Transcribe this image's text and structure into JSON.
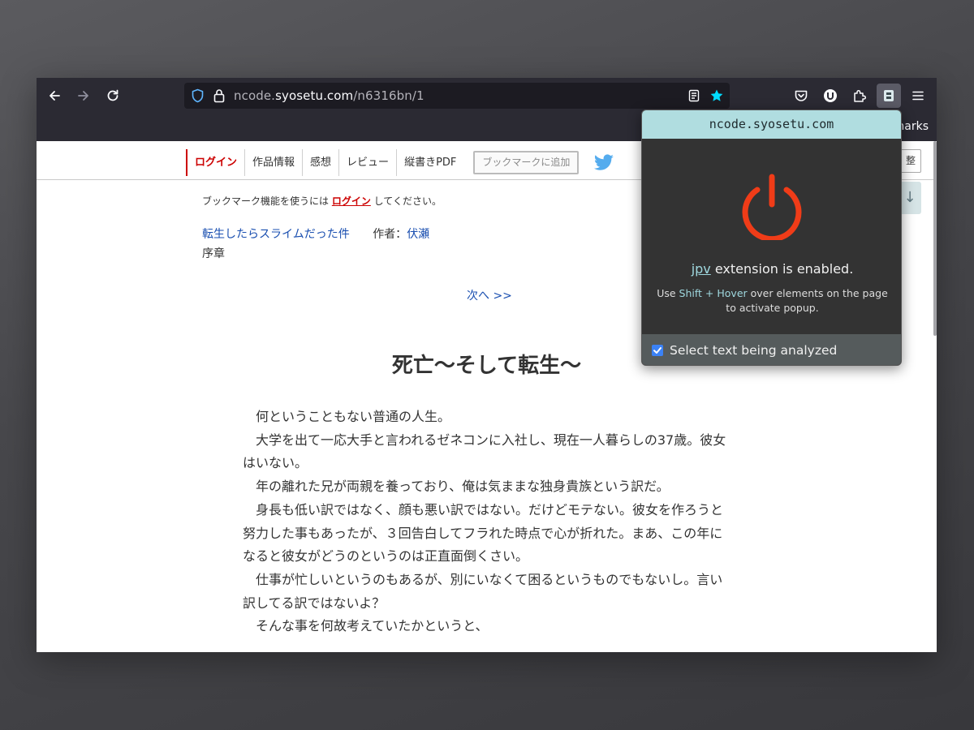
{
  "browser": {
    "url_host_prefix": "ncode.",
    "url_host_main": "syosetu.com",
    "url_path": "/n6316bn/1",
    "bookmarks_label": "harks"
  },
  "nav": {
    "login": "ログイン",
    "work_info": "作品情報",
    "impressions": "感想",
    "review": "レビュー",
    "vertical_pdf": "縦書きPDF",
    "add_bookmark": "ブックマークに追加",
    "adjust": "整",
    "down_arrow": "↓"
  },
  "notice": {
    "before": "ブックマーク機能を使うには ",
    "login": "ログイン",
    "after": " してください。"
  },
  "series": {
    "title": "転生したらスライムだった件",
    "author_label": "作者：",
    "author": "伏瀬",
    "chapter": "序章"
  },
  "next_label": "次へ >>",
  "chapter_title": "死亡～そして転生～",
  "paragraphs": [
    "何ということもない普通の人生。",
    "大学を出て一応大手と言われるゼネコンに入社し、現在一人暮らしの37歳。彼女はいない。",
    "年の離れた兄が両親を養っており、俺は気ままな独身貴族という訳だ。",
    "身長も低い訳ではなく、顔も悪い訳ではない。だけどモテない。彼女を作ろうと努力した事もあったが、３回告白してフラれた時点で心が折れた。まあ、この年になると彼女がどうのというのは正直面倒くさい。",
    "仕事が忙しいというのもあるが、別にいなくて困るというものでもないし。言い訳してる訳ではないよ？",
    "そんな事を何故考えていたかというと、"
  ],
  "popup": {
    "domain": "ncode.syosetu.com",
    "ext_name": "jpv",
    "status_suffix": " extension is enabled.",
    "hint_use": "Use ",
    "hint_keys": "Shift + Hover",
    "hint_rest": " over elements on the page to activate popup.",
    "checkbox_label": "Select text being analyzed",
    "checkbox_checked": true
  },
  "colors": {
    "power_icon": "#f03c18",
    "popup_header": "#b0dde0",
    "accent_link": "#1a4fb0",
    "login_red": "#cc0000"
  }
}
